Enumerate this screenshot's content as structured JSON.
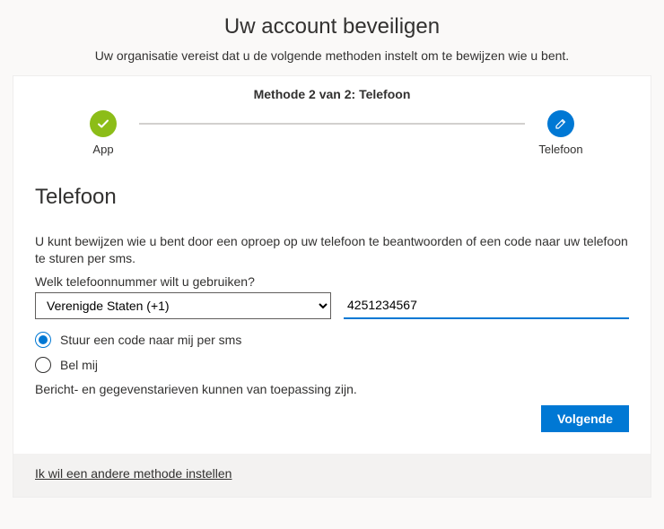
{
  "header": {
    "title": "Uw account beveiligen",
    "subtitle": "Uw organisatie vereist dat u de volgende methoden instelt om te bewijzen wie u bent."
  },
  "stepper": {
    "heading": "Methode 2 van 2: Telefoon",
    "steps": [
      {
        "label": "App",
        "state": "done"
      },
      {
        "label": "Telefoon",
        "state": "active"
      }
    ]
  },
  "section": {
    "title": "Telefoon",
    "description": "U kunt bewijzen wie u bent door een oproep op uw telefoon te beantwoorden of een code naar uw telefoon te sturen per sms.",
    "field_label": "Welk telefoonnummer wilt u gebruiken?",
    "country_selected": "Verenigde Staten (+1)",
    "phone_value": "4251234567",
    "options": {
      "sms": "Stuur een code naar mij per sms",
      "call": "Bel mij",
      "selected": "sms"
    },
    "rates_note": "Bericht- en gegevenstarieven kunnen van toepassing zijn.",
    "next_label": "Volgende"
  },
  "footer": {
    "alt_method": "Ik wil een andere methode instellen"
  }
}
